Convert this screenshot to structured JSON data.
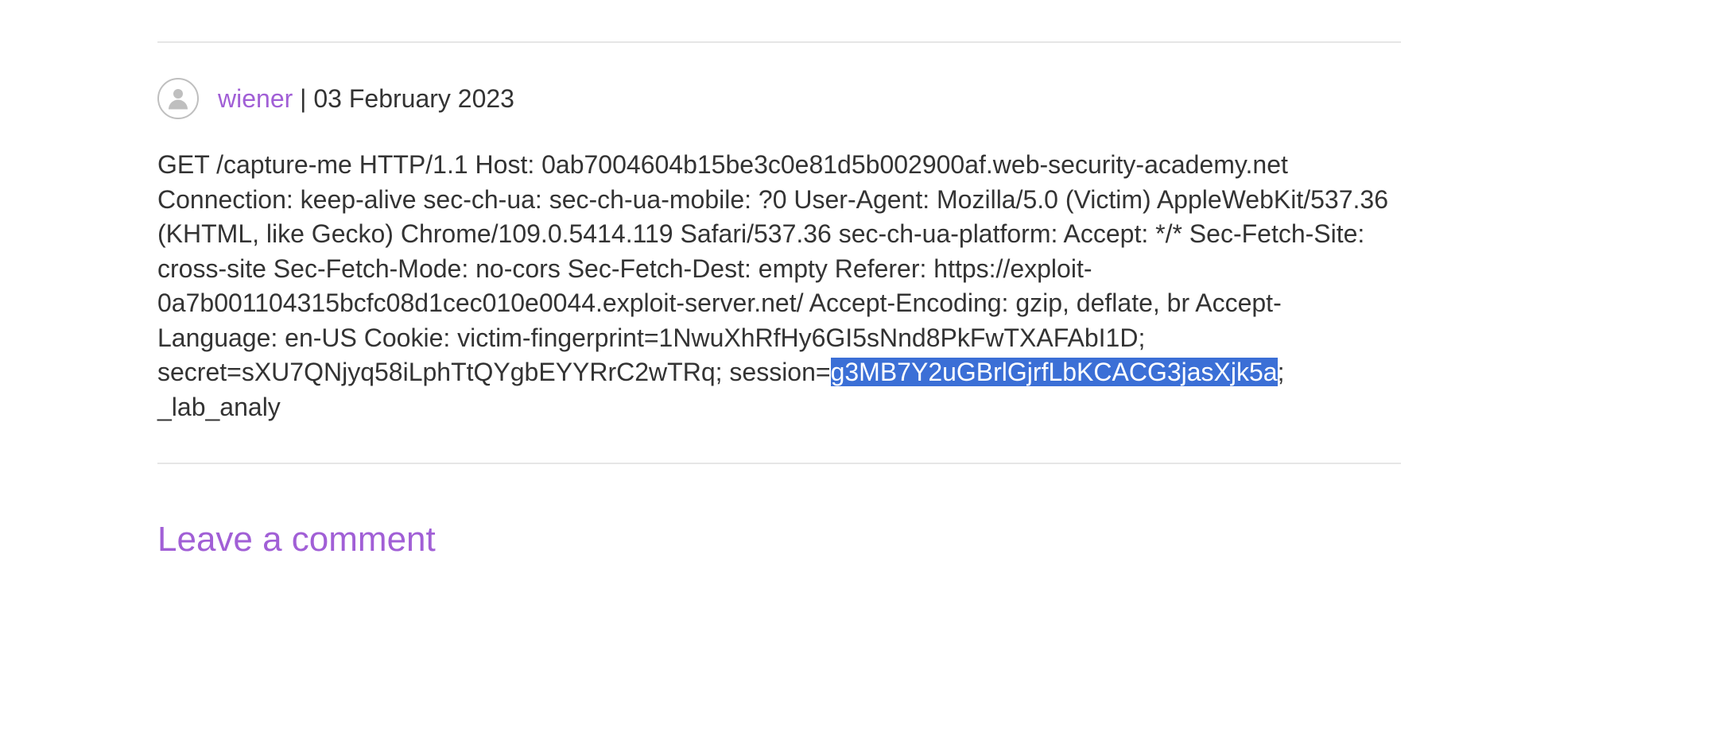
{
  "comment": {
    "author": "wiener",
    "separator": " | ",
    "date": "03 February 2023",
    "body_before_highlight": "GET /capture-me HTTP/1.1 Host: 0ab7004604b15be3c0e81d5b002900af.web-security-academy.net Connection: keep-alive sec-ch-ua: sec-ch-ua-mobile: ?0 User-Agent: Mozilla/5.0 (Victim) AppleWebKit/537.36 (KHTML, like Gecko) Chrome/109.0.5414.119 Safari/537.36 sec-ch-ua-platform: Accept: */* Sec-Fetch-Site: cross-site Sec-Fetch-Mode: no-cors Sec-Fetch-Dest: empty Referer: https://exploit-0a7b001104315bcfc08d1cec010e0044.exploit-server.net/ Accept-Encoding: gzip, deflate, br Accept-Language: en-US Cookie: victim-fingerprint=1NwuXhRfHy6GI5sNnd8PkFwTXAFAbI1D; secret=sXU7QNjyq58iLphTtQYgbEYYRrC2wTRq; session=",
    "body_highlight": "g3MB7Y2uGBrlGjrfLbKCACG3jasXjk5a",
    "body_after_highlight": "; _lab_analy"
  },
  "form": {
    "heading": "Leave a comment"
  }
}
